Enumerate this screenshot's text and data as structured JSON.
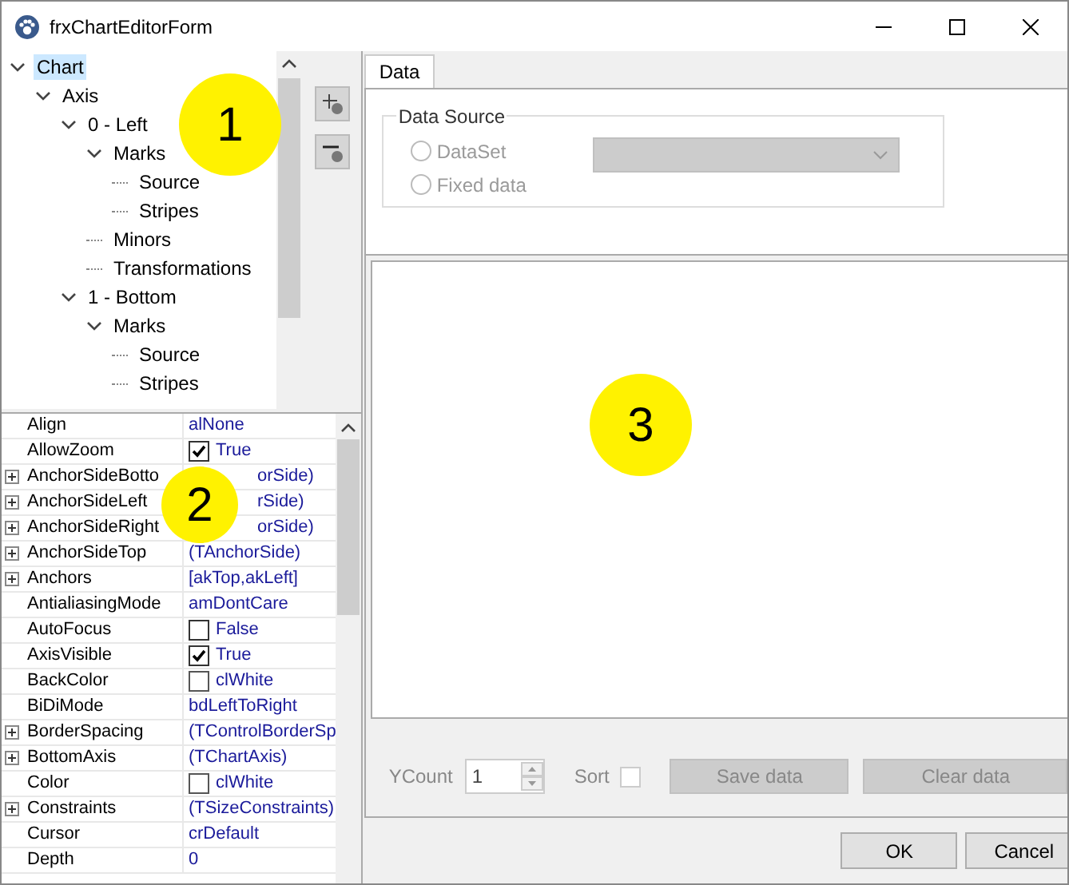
{
  "window": {
    "title": "frxChartEditorForm"
  },
  "tree": [
    {
      "label": "Chart",
      "selected": true,
      "expanded": true,
      "children": [
        {
          "label": "Axis",
          "selected": false,
          "expanded": true,
          "children": [
            {
              "label": "0 - Left",
              "selected": false,
              "expanded": true,
              "children": [
                {
                  "label": "Marks",
                  "selected": false,
                  "expanded": true,
                  "children": [
                    {
                      "label": "Source",
                      "selected": false
                    },
                    {
                      "label": "Stripes",
                      "selected": false
                    }
                  ]
                },
                {
                  "label": "Minors",
                  "selected": false
                },
                {
                  "label": "Transformations",
                  "selected": false
                }
              ]
            },
            {
              "label": "1 - Bottom",
              "selected": false,
              "expanded": true,
              "children": [
                {
                  "label": "Marks",
                  "selected": false,
                  "expanded": true,
                  "children": [
                    {
                      "label": "Source",
                      "selected": false
                    },
                    {
                      "label": "Stripes",
                      "selected": false
                    }
                  ]
                }
              ]
            }
          ]
        }
      ]
    }
  ],
  "properties": [
    {
      "name": "Align",
      "value": "alNone",
      "expandable": false,
      "kind": "text"
    },
    {
      "name": "AllowZoom",
      "value": "True",
      "expandable": false,
      "kind": "checkbox",
      "checked": true
    },
    {
      "name": "AnchorSideBotto",
      "value": "orSide)",
      "expandable": true,
      "kind": "text",
      "obscured": true
    },
    {
      "name": "AnchorSideLeft",
      "value": "rSide)",
      "expandable": true,
      "kind": "text",
      "obscured": true
    },
    {
      "name": "AnchorSideRight",
      "value": "orSide)",
      "expandable": true,
      "kind": "text",
      "obscured": true
    },
    {
      "name": "AnchorSideTop",
      "value": "(TAnchorSide)",
      "expandable": true,
      "kind": "text",
      "obscured": false
    },
    {
      "name": "Anchors",
      "value": "[akTop,akLeft]",
      "expandable": true,
      "kind": "text"
    },
    {
      "name": "AntialiasingMode",
      "value": "amDontCare",
      "expandable": false,
      "kind": "text"
    },
    {
      "name": "AutoFocus",
      "value": "False",
      "expandable": false,
      "kind": "checkbox",
      "checked": false
    },
    {
      "name": "AxisVisible",
      "value": "True",
      "expandable": false,
      "kind": "checkbox",
      "checked": true
    },
    {
      "name": "BackColor",
      "value": "clWhite",
      "expandable": false,
      "kind": "color",
      "color": "#ffffff"
    },
    {
      "name": "BiDiMode",
      "value": "bdLeftToRight",
      "expandable": false,
      "kind": "text"
    },
    {
      "name": "BorderSpacing",
      "value": "(TControlBorderSp",
      "expandable": true,
      "kind": "text"
    },
    {
      "name": "BottomAxis",
      "value": "(TChartAxis)",
      "expandable": true,
      "kind": "text"
    },
    {
      "name": "Color",
      "value": "clWhite",
      "expandable": false,
      "kind": "color",
      "color": "#ffffff"
    },
    {
      "name": "Constraints",
      "value": "(TSizeConstraints)",
      "expandable": true,
      "kind": "text"
    },
    {
      "name": "Cursor",
      "value": "crDefault",
      "expandable": false,
      "kind": "text"
    },
    {
      "name": "Depth",
      "value": "0",
      "expandable": false,
      "kind": "text"
    }
  ],
  "tabs": [
    {
      "label": "Data",
      "selected": true
    }
  ],
  "data_source": {
    "title": "Data Source",
    "options": [
      {
        "label": "DataSet",
        "selected": false,
        "disabled": true
      },
      {
        "label": "Fixed data",
        "selected": false,
        "disabled": true
      }
    ],
    "combo_disabled": true
  },
  "ycount": {
    "label": "YCount",
    "value": "1"
  },
  "sort": {
    "label": "Sort",
    "checked": false
  },
  "data_buttons": [
    {
      "label": "Save data",
      "disabled": true
    },
    {
      "label": "Clear data",
      "disabled": true
    }
  ],
  "buttons": [
    "OK",
    "Cancel"
  ],
  "callouts": [
    "1",
    "2",
    "3"
  ]
}
